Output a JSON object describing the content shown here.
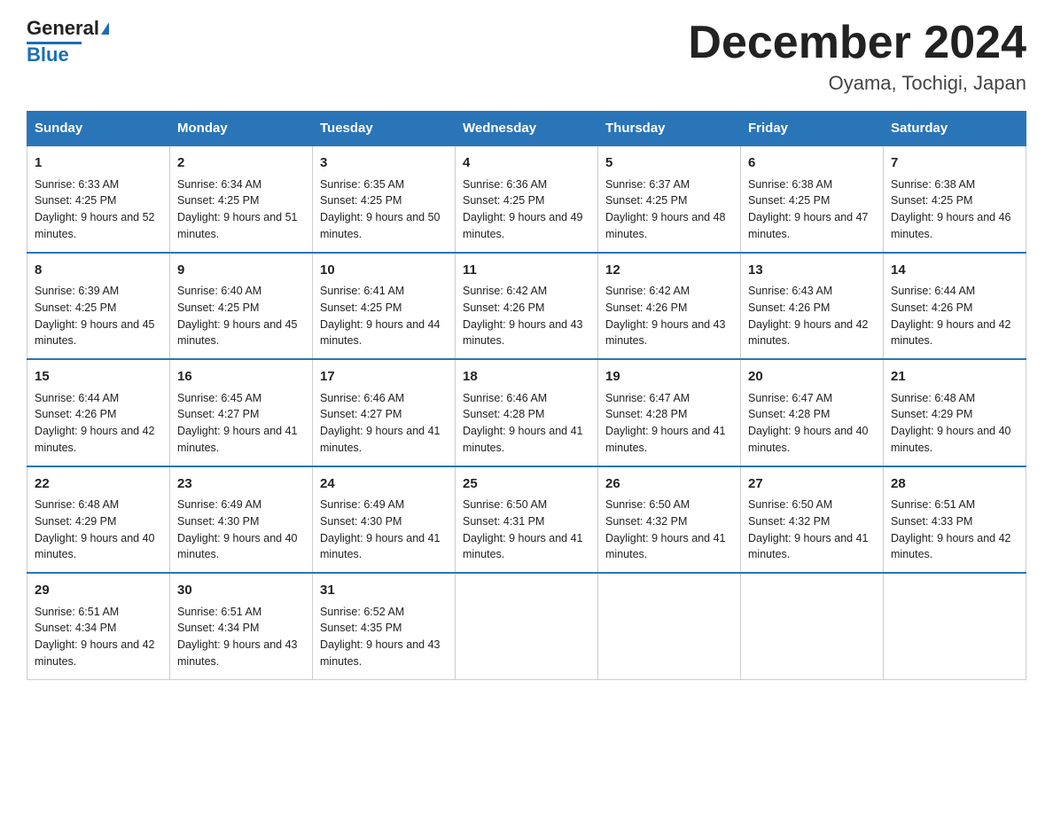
{
  "header": {
    "logo_general": "General",
    "logo_blue": "Blue",
    "month_title": "December 2024",
    "location": "Oyama, Tochigi, Japan"
  },
  "columns": [
    "Sunday",
    "Monday",
    "Tuesday",
    "Wednesday",
    "Thursday",
    "Friday",
    "Saturday"
  ],
  "weeks": [
    [
      {
        "day": "1",
        "sunrise": "Sunrise: 6:33 AM",
        "sunset": "Sunset: 4:25 PM",
        "daylight": "Daylight: 9 hours and 52 minutes."
      },
      {
        "day": "2",
        "sunrise": "Sunrise: 6:34 AM",
        "sunset": "Sunset: 4:25 PM",
        "daylight": "Daylight: 9 hours and 51 minutes."
      },
      {
        "day": "3",
        "sunrise": "Sunrise: 6:35 AM",
        "sunset": "Sunset: 4:25 PM",
        "daylight": "Daylight: 9 hours and 50 minutes."
      },
      {
        "day": "4",
        "sunrise": "Sunrise: 6:36 AM",
        "sunset": "Sunset: 4:25 PM",
        "daylight": "Daylight: 9 hours and 49 minutes."
      },
      {
        "day": "5",
        "sunrise": "Sunrise: 6:37 AM",
        "sunset": "Sunset: 4:25 PM",
        "daylight": "Daylight: 9 hours and 48 minutes."
      },
      {
        "day": "6",
        "sunrise": "Sunrise: 6:38 AM",
        "sunset": "Sunset: 4:25 PM",
        "daylight": "Daylight: 9 hours and 47 minutes."
      },
      {
        "day": "7",
        "sunrise": "Sunrise: 6:38 AM",
        "sunset": "Sunset: 4:25 PM",
        "daylight": "Daylight: 9 hours and 46 minutes."
      }
    ],
    [
      {
        "day": "8",
        "sunrise": "Sunrise: 6:39 AM",
        "sunset": "Sunset: 4:25 PM",
        "daylight": "Daylight: 9 hours and 45 minutes."
      },
      {
        "day": "9",
        "sunrise": "Sunrise: 6:40 AM",
        "sunset": "Sunset: 4:25 PM",
        "daylight": "Daylight: 9 hours and 45 minutes."
      },
      {
        "day": "10",
        "sunrise": "Sunrise: 6:41 AM",
        "sunset": "Sunset: 4:25 PM",
        "daylight": "Daylight: 9 hours and 44 minutes."
      },
      {
        "day": "11",
        "sunrise": "Sunrise: 6:42 AM",
        "sunset": "Sunset: 4:26 PM",
        "daylight": "Daylight: 9 hours and 43 minutes."
      },
      {
        "day": "12",
        "sunrise": "Sunrise: 6:42 AM",
        "sunset": "Sunset: 4:26 PM",
        "daylight": "Daylight: 9 hours and 43 minutes."
      },
      {
        "day": "13",
        "sunrise": "Sunrise: 6:43 AM",
        "sunset": "Sunset: 4:26 PM",
        "daylight": "Daylight: 9 hours and 42 minutes."
      },
      {
        "day": "14",
        "sunrise": "Sunrise: 6:44 AM",
        "sunset": "Sunset: 4:26 PM",
        "daylight": "Daylight: 9 hours and 42 minutes."
      }
    ],
    [
      {
        "day": "15",
        "sunrise": "Sunrise: 6:44 AM",
        "sunset": "Sunset: 4:26 PM",
        "daylight": "Daylight: 9 hours and 42 minutes."
      },
      {
        "day": "16",
        "sunrise": "Sunrise: 6:45 AM",
        "sunset": "Sunset: 4:27 PM",
        "daylight": "Daylight: 9 hours and 41 minutes."
      },
      {
        "day": "17",
        "sunrise": "Sunrise: 6:46 AM",
        "sunset": "Sunset: 4:27 PM",
        "daylight": "Daylight: 9 hours and 41 minutes."
      },
      {
        "day": "18",
        "sunrise": "Sunrise: 6:46 AM",
        "sunset": "Sunset: 4:28 PM",
        "daylight": "Daylight: 9 hours and 41 minutes."
      },
      {
        "day": "19",
        "sunrise": "Sunrise: 6:47 AM",
        "sunset": "Sunset: 4:28 PM",
        "daylight": "Daylight: 9 hours and 41 minutes."
      },
      {
        "day": "20",
        "sunrise": "Sunrise: 6:47 AM",
        "sunset": "Sunset: 4:28 PM",
        "daylight": "Daylight: 9 hours and 40 minutes."
      },
      {
        "day": "21",
        "sunrise": "Sunrise: 6:48 AM",
        "sunset": "Sunset: 4:29 PM",
        "daylight": "Daylight: 9 hours and 40 minutes."
      }
    ],
    [
      {
        "day": "22",
        "sunrise": "Sunrise: 6:48 AM",
        "sunset": "Sunset: 4:29 PM",
        "daylight": "Daylight: 9 hours and 40 minutes."
      },
      {
        "day": "23",
        "sunrise": "Sunrise: 6:49 AM",
        "sunset": "Sunset: 4:30 PM",
        "daylight": "Daylight: 9 hours and 40 minutes."
      },
      {
        "day": "24",
        "sunrise": "Sunrise: 6:49 AM",
        "sunset": "Sunset: 4:30 PM",
        "daylight": "Daylight: 9 hours and 41 minutes."
      },
      {
        "day": "25",
        "sunrise": "Sunrise: 6:50 AM",
        "sunset": "Sunset: 4:31 PM",
        "daylight": "Daylight: 9 hours and 41 minutes."
      },
      {
        "day": "26",
        "sunrise": "Sunrise: 6:50 AM",
        "sunset": "Sunset: 4:32 PM",
        "daylight": "Daylight: 9 hours and 41 minutes."
      },
      {
        "day": "27",
        "sunrise": "Sunrise: 6:50 AM",
        "sunset": "Sunset: 4:32 PM",
        "daylight": "Daylight: 9 hours and 41 minutes."
      },
      {
        "day": "28",
        "sunrise": "Sunrise: 6:51 AM",
        "sunset": "Sunset: 4:33 PM",
        "daylight": "Daylight: 9 hours and 42 minutes."
      }
    ],
    [
      {
        "day": "29",
        "sunrise": "Sunrise: 6:51 AM",
        "sunset": "Sunset: 4:34 PM",
        "daylight": "Daylight: 9 hours and 42 minutes."
      },
      {
        "day": "30",
        "sunrise": "Sunrise: 6:51 AM",
        "sunset": "Sunset: 4:34 PM",
        "daylight": "Daylight: 9 hours and 43 minutes."
      },
      {
        "day": "31",
        "sunrise": "Sunrise: 6:52 AM",
        "sunset": "Sunset: 4:35 PM",
        "daylight": "Daylight: 9 hours and 43 minutes."
      },
      null,
      null,
      null,
      null
    ]
  ]
}
